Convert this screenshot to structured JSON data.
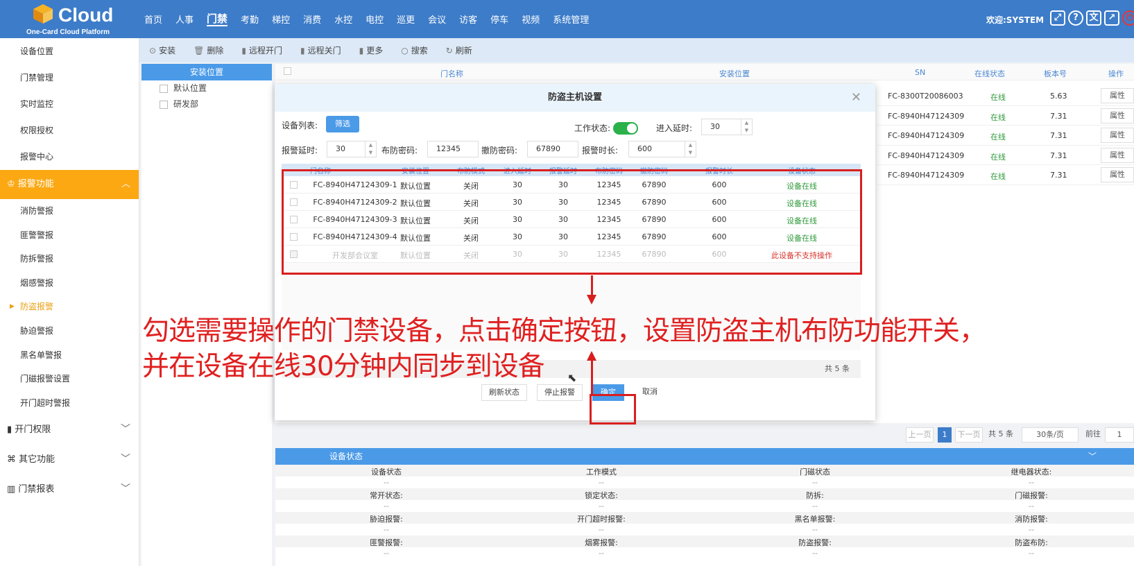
{
  "header": {
    "logo_text": "Cloud",
    "logo_sub": "One-Card Cloud Platform",
    "nav": [
      "首页",
      "人事",
      "门禁",
      "考勤",
      "梯控",
      "消费",
      "水控",
      "电控",
      "巡更",
      "会议",
      "访客",
      "停车",
      "视频",
      "系统管理"
    ],
    "welcome": "欢迎:SYSTEM",
    "colors": {
      "primary": "#3d7cc9",
      "accent": "#fba813"
    }
  },
  "sidebar": {
    "top_items": [
      "设备位置",
      "门禁管理",
      "实时监控",
      "权限授权",
      "报警中心"
    ],
    "group_label": "报警功能",
    "sub_items": [
      "消防警报",
      "匪警警报",
      "防拆警报",
      "烟感警报",
      "防盗报警",
      "胁迫警报",
      "黑名单警报",
      "门磁报警设置",
      "开门超时警报"
    ],
    "menus": [
      "开门权限",
      "其它功能",
      "门禁报表"
    ]
  },
  "toolbar": [
    "安装",
    "删除",
    "远程开门",
    "远程关门",
    "更多",
    "搜索",
    "刷新"
  ],
  "location": {
    "header": "安装位置",
    "items": [
      "默认位置",
      "研发部"
    ]
  },
  "main_table": {
    "headers": [
      "门名称",
      "安装位置",
      "SN",
      "在线状态",
      "板本号",
      "操作"
    ],
    "rows": [
      {
        "sn": "FC-8300T20086003",
        "status": "在线",
        "ver": "5.63",
        "op": "属性"
      },
      {
        "sn": "FC-8940H47124309",
        "status": "在线",
        "ver": "7.31",
        "op": "属性"
      },
      {
        "sn": "FC-8940H47124309",
        "status": "在线",
        "ver": "7.31",
        "op": "属性"
      },
      {
        "sn": "FC-8940H47124309",
        "status": "在线",
        "ver": "7.31",
        "op": "属性"
      },
      {
        "sn": "FC-8940H47124309",
        "status": "在线",
        "ver": "7.31",
        "op": "属性"
      }
    ]
  },
  "pager": {
    "prev": "上一页",
    "page": "1",
    "next": "下一页",
    "total": "共 5 条",
    "size": "30条/页",
    "goto": "前往",
    "goto_val": "1"
  },
  "status_panel": {
    "title": "设备状态",
    "rows": [
      [
        "设备状态",
        "工作模式",
        "门磁状态",
        "继电器状态:"
      ],
      [
        "常开状态:",
        "锁定状态:",
        "防拆:",
        "门磁报警:"
      ],
      [
        "胁迫报警:",
        "开门超时报警:",
        "黑名单报警:",
        "消防报警:"
      ],
      [
        "匪警报警:",
        "烟雾报警:",
        "防盗报警:",
        "防盗布防:"
      ]
    ],
    "dash": "--"
  },
  "dialog": {
    "title": "防盗主机设置",
    "device_list_label": "设备列表:",
    "filter_btn": "筛选",
    "work_status_label": "工作状态:",
    "work_status_on": true,
    "entry_delay_label": "进入延时:",
    "entry_delay": "30",
    "alarm_delay_label": "报警延时:",
    "alarm_delay": "30",
    "arm_pwd_label": "布防密码:",
    "arm_pwd": "12345",
    "disarm_pwd_label": "撤防密码:",
    "disarm_pwd": "67890",
    "alarm_dur_label": "报警时长:",
    "alarm_dur": "600",
    "table_headers": [
      "门名称",
      "安装位置",
      "布防模式",
      "进入延时",
      "报警延时",
      "布防密码",
      "撤防密码",
      "报警时长",
      "设备状态"
    ],
    "rows": [
      [
        "FC-8940H47124309-1",
        "默认位置",
        "关闭",
        "30",
        "30",
        "12345",
        "67890",
        "600",
        "设备在线"
      ],
      [
        "FC-8940H47124309-2",
        "默认位置",
        "关闭",
        "30",
        "30",
        "12345",
        "67890",
        "600",
        "设备在线"
      ],
      [
        "FC-8940H47124309-3",
        "默认位置",
        "关闭",
        "30",
        "30",
        "12345",
        "67890",
        "600",
        "设备在线"
      ],
      [
        "FC-8940H47124309-4",
        "默认位置",
        "关闭",
        "30",
        "30",
        "12345",
        "67890",
        "600",
        "设备在线"
      ],
      [
        "开发部会议室",
        "默认位置",
        "关闭",
        "30",
        "30",
        "12345",
        "67890",
        "600",
        "此设备不支持操作"
      ]
    ],
    "total": "共 5 条",
    "btn_refresh": "刷新状态",
    "btn_stop": "停止报警",
    "btn_ok": "确定",
    "btn_cancel": "取消"
  },
  "annotation": {
    "line1": "勾选需要操作的门禁设备，点击确定按钮，设置防盗主机布防功能开关，",
    "line2": "并在设备在线30分钟内同步到设备"
  }
}
